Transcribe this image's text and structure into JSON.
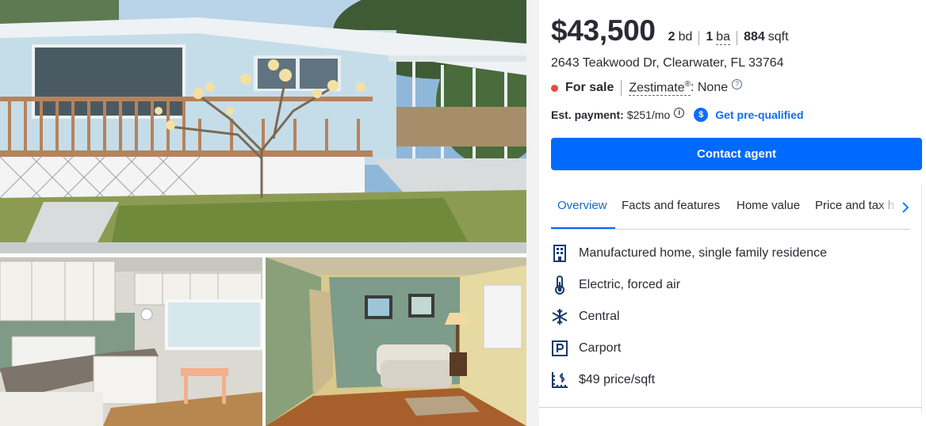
{
  "listing": {
    "price": "$43,500",
    "beds_value": "2",
    "beds_unit": "bd",
    "baths_value": "1",
    "baths_unit": "ba",
    "sqft_value": "884",
    "sqft_unit": "sqft",
    "address": "2643 Teakwood Dr, Clearwater, FL 33764",
    "status": "For sale",
    "zestimate_label": "Zestimate",
    "zestimate_mark": "®",
    "zestimate_value": ": None",
    "payment_label": "Est. payment:",
    "payment_value": "$251/mo",
    "prequalified_label": "Get pre-qualified",
    "contact_label": "Contact agent"
  },
  "tabs": [
    {
      "label": "Overview",
      "active": true
    },
    {
      "label": "Facts and features",
      "active": false
    },
    {
      "label": "Home value",
      "active": false
    },
    {
      "label": "Price and tax h",
      "active": false
    }
  ],
  "features": [
    {
      "icon": "building-icon",
      "text": "Manufactured home, single family residence"
    },
    {
      "icon": "thermometer-icon",
      "text": "Electric, forced air"
    },
    {
      "icon": "snowflake-icon",
      "text": "Central"
    },
    {
      "icon": "parking-icon",
      "text": "Carport"
    },
    {
      "icon": "price-per-sqft-icon",
      "text": "$49 price/sqft"
    }
  ],
  "colors": {
    "accent": "#006aff",
    "link": "#0d6efd",
    "status_dot": "#e84c3d",
    "text": "#2a2a33"
  }
}
